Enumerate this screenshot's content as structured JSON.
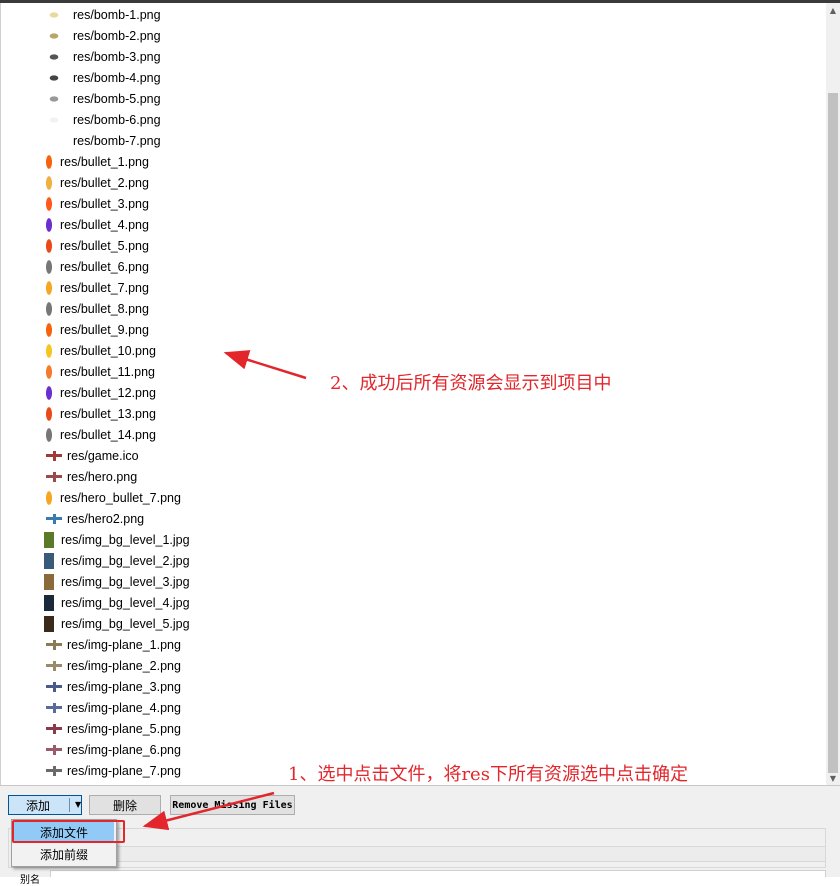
{
  "files": [
    {
      "name": "res/bomb-1.png",
      "icon": "bomb-icon",
      "color": "#e8d9a0"
    },
    {
      "name": "res/bomb-2.png",
      "icon": "bomb-icon",
      "color": "#b9a46a"
    },
    {
      "name": "res/bomb-3.png",
      "icon": "bomb-icon",
      "color": "#555555"
    },
    {
      "name": "res/bomb-4.png",
      "icon": "bomb-icon",
      "color": "#444444"
    },
    {
      "name": "res/bomb-5.png",
      "icon": "bomb-icon",
      "color": "#999999"
    },
    {
      "name": "res/bomb-6.png",
      "icon": "bomb-icon",
      "color": "#f2f2f2"
    },
    {
      "name": "res/bomb-7.png",
      "icon": "bomb-icon",
      "color": "#ffffff"
    },
    {
      "name": "res/bullet_1.png",
      "icon": "bullet-icon",
      "color": "#f7630c"
    },
    {
      "name": "res/bullet_2.png",
      "icon": "bullet-icon",
      "color": "#f0b040"
    },
    {
      "name": "res/bullet_3.png",
      "icon": "bullet-icon",
      "color": "#ff5a1a"
    },
    {
      "name": "res/bullet_4.png",
      "icon": "bullet-icon",
      "color": "#6a2fd0"
    },
    {
      "name": "res/bullet_5.png",
      "icon": "bullet-icon",
      "color": "#e84a1a"
    },
    {
      "name": "res/bullet_6.png",
      "icon": "bullet-icon",
      "color": "#777777"
    },
    {
      "name": "res/bullet_7.png",
      "icon": "bullet-icon",
      "color": "#f5a623"
    },
    {
      "name": "res/bullet_8.png",
      "icon": "bullet-icon",
      "color": "#777777"
    },
    {
      "name": "res/bullet_9.png",
      "icon": "bullet-icon",
      "color": "#f7630c"
    },
    {
      "name": "res/bullet_10.png",
      "icon": "bullet-icon",
      "color": "#f5c623"
    },
    {
      "name": "res/bullet_11.png",
      "icon": "bullet-icon",
      "color": "#f77a2c"
    },
    {
      "name": "res/bullet_12.png",
      "icon": "bullet-icon",
      "color": "#6a2fd0"
    },
    {
      "name": "res/bullet_13.png",
      "icon": "bullet-icon",
      "color": "#e84a1a"
    },
    {
      "name": "res/bullet_14.png",
      "icon": "bullet-icon",
      "color": "#777777"
    },
    {
      "name": "res/game.ico",
      "icon": "plane-icon",
      "color": "#a03a3a"
    },
    {
      "name": "res/hero.png",
      "icon": "plane-icon",
      "color": "#9a4a4a"
    },
    {
      "name": "res/hero_bullet_7.png",
      "icon": "bullet-icon",
      "color": "#f5a623"
    },
    {
      "name": "res/hero2.png",
      "icon": "plane-icon",
      "color": "#3a7ab0"
    },
    {
      "name": "res/img_bg_level_1.jpg",
      "icon": "background-image-icon",
      "color": "#5a7a2a"
    },
    {
      "name": "res/img_bg_level_2.jpg",
      "icon": "background-image-icon",
      "color": "#3a5a7a"
    },
    {
      "name": "res/img_bg_level_3.jpg",
      "icon": "background-image-icon",
      "color": "#8a6a3a"
    },
    {
      "name": "res/img_bg_level_4.jpg",
      "icon": "background-image-icon",
      "color": "#1a2a3a"
    },
    {
      "name": "res/img_bg_level_5.jpg",
      "icon": "background-image-icon",
      "color": "#3a2a1a"
    },
    {
      "name": "res/img-plane_1.png",
      "icon": "plane-icon",
      "color": "#8a7a5a"
    },
    {
      "name": "res/img-plane_2.png",
      "icon": "plane-icon",
      "color": "#9a8a6a"
    },
    {
      "name": "res/img-plane_3.png",
      "icon": "plane-icon",
      "color": "#4a5a8a"
    },
    {
      "name": "res/img-plane_4.png",
      "icon": "plane-icon",
      "color": "#5a6a9a"
    },
    {
      "name": "res/img-plane_5.png",
      "icon": "plane-icon",
      "color": "#8a3a4a"
    },
    {
      "name": "res/img-plane_6.png",
      "icon": "plane-icon",
      "color": "#9a5a6a"
    },
    {
      "name": "res/img-plane_7.png",
      "icon": "plane-icon",
      "color": "#6a6a6a"
    }
  ],
  "toolbar": {
    "add_label": "添加",
    "delete_label": "删除",
    "remove_missing_label": "Remove Missing Files"
  },
  "menu": {
    "add_files_label": "添加文件",
    "add_prefix_label": "添加前缀"
  },
  "annotations": {
    "step1": "1、选中点击文件，将res下所有资源选中点击确定",
    "step2": "2、成功后所有资源会显示到项目中"
  },
  "bottom_cut_label": "别名",
  "colors": {
    "annotation_red": "#e2262b",
    "menu_highlight": "#91c9f7"
  }
}
